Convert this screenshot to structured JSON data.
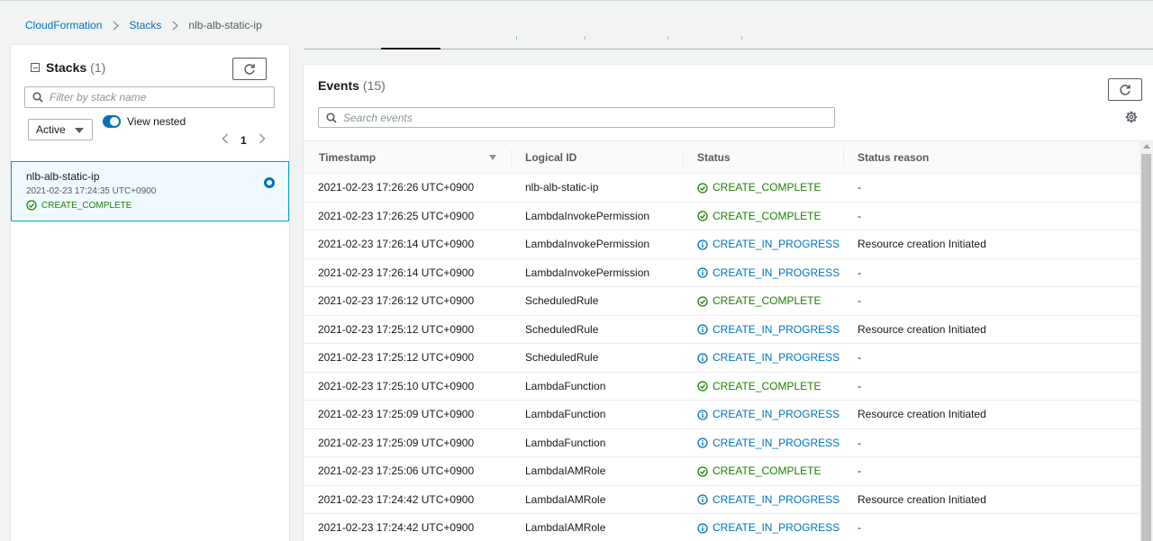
{
  "breadcrumb": {
    "items": [
      "CloudFormation",
      "Stacks"
    ],
    "current": "nlb-alb-static-ip"
  },
  "stacks_panel": {
    "title": "Stacks",
    "count": "(1)",
    "filter_placeholder": "Filter by stack name",
    "status_filter": "Active",
    "view_nested_label": "View nested",
    "view_nested_enabled": true,
    "page": "1",
    "stack": {
      "name": "nlb-alb-static-ip",
      "date": "2021-02-23 17:24:35 UTC+0900",
      "status": "CREATE_COMPLETE"
    }
  },
  "events_panel": {
    "title": "Events",
    "count": "(15)",
    "search_placeholder": "Search events",
    "columns": [
      "Timestamp",
      "Logical ID",
      "Status",
      "Status reason"
    ],
    "rows": [
      {
        "timestamp": "2021-02-23 17:26:26 UTC+0900",
        "logical_id": "nlb-alb-static-ip",
        "status": "CREATE_COMPLETE",
        "reason": "-"
      },
      {
        "timestamp": "2021-02-23 17:26:25 UTC+0900",
        "logical_id": "LambdaInvokePermission",
        "status": "CREATE_COMPLETE",
        "reason": "-"
      },
      {
        "timestamp": "2021-02-23 17:26:14 UTC+0900",
        "logical_id": "LambdaInvokePermission",
        "status": "CREATE_IN_PROGRESS",
        "reason": "Resource creation Initiated"
      },
      {
        "timestamp": "2021-02-23 17:26:14 UTC+0900",
        "logical_id": "LambdaInvokePermission",
        "status": "CREATE_IN_PROGRESS",
        "reason": "-"
      },
      {
        "timestamp": "2021-02-23 17:26:12 UTC+0900",
        "logical_id": "ScheduledRule",
        "status": "CREATE_COMPLETE",
        "reason": "-"
      },
      {
        "timestamp": "2021-02-23 17:25:12 UTC+0900",
        "logical_id": "ScheduledRule",
        "status": "CREATE_IN_PROGRESS",
        "reason": "Resource creation Initiated"
      },
      {
        "timestamp": "2021-02-23 17:25:12 UTC+0900",
        "logical_id": "ScheduledRule",
        "status": "CREATE_IN_PROGRESS",
        "reason": "-"
      },
      {
        "timestamp": "2021-02-23 17:25:10 UTC+0900",
        "logical_id": "LambdaFunction",
        "status": "CREATE_COMPLETE",
        "reason": "-"
      },
      {
        "timestamp": "2021-02-23 17:25:09 UTC+0900",
        "logical_id": "LambdaFunction",
        "status": "CREATE_IN_PROGRESS",
        "reason": "Resource creation Initiated"
      },
      {
        "timestamp": "2021-02-23 17:25:09 UTC+0900",
        "logical_id": "LambdaFunction",
        "status": "CREATE_IN_PROGRESS",
        "reason": "-"
      },
      {
        "timestamp": "2021-02-23 17:25:06 UTC+0900",
        "logical_id": "LambdaIAMRole",
        "status": "CREATE_COMPLETE",
        "reason": "-"
      },
      {
        "timestamp": "2021-02-23 17:24:42 UTC+0900",
        "logical_id": "LambdaIAMRole",
        "status": "CREATE_IN_PROGRESS",
        "reason": "Resource creation Initiated"
      },
      {
        "timestamp": "2021-02-23 17:24:42 UTC+0900",
        "logical_id": "LambdaIAMRole",
        "status": "CREATE_IN_PROGRESS",
        "reason": "-"
      }
    ]
  },
  "colors": {
    "link": "#0073bb",
    "success": "#1d8102",
    "in_progress": "#0073bb",
    "selected_border": "#00a1c9"
  },
  "icons": {
    "complete": "check-circle-icon",
    "in_progress": "info-circle-icon",
    "refresh": "refresh-icon",
    "search": "search-icon",
    "settings": "gear-icon"
  }
}
